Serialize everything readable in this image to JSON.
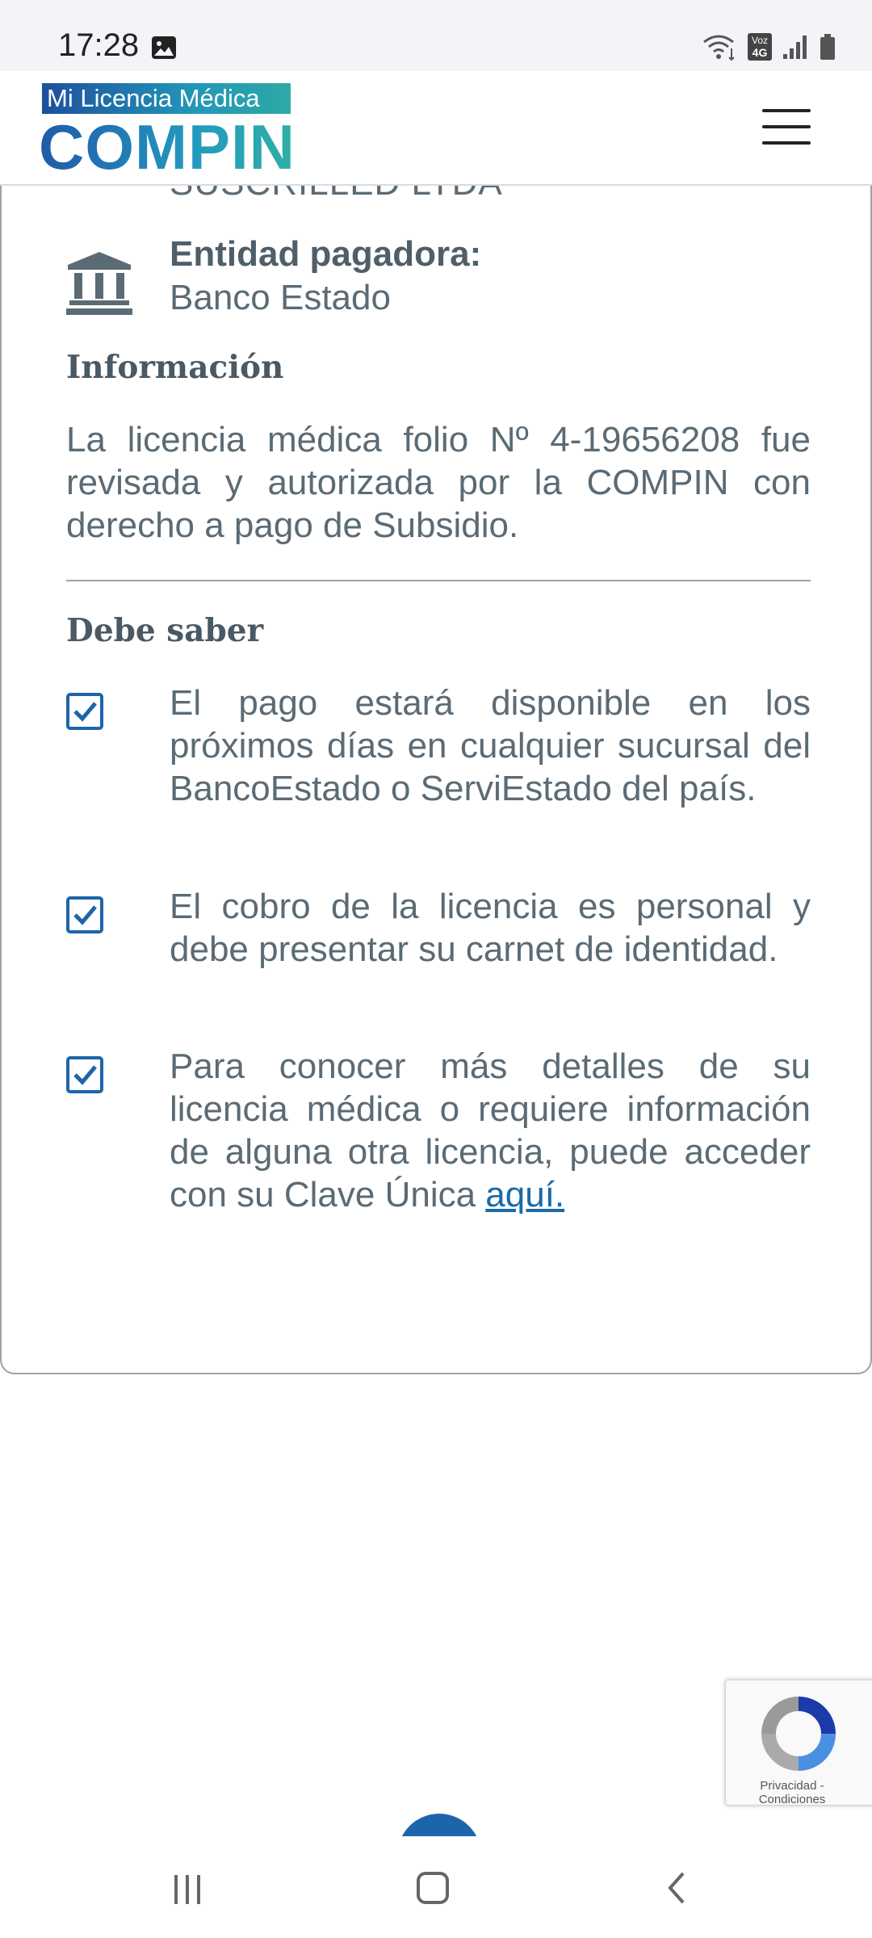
{
  "status_bar": {
    "time": "17:28",
    "icons": [
      "gallery-icon",
      "wifi-icon",
      "volte-icon",
      "signal-icon",
      "battery-icon"
    ],
    "volte_top": "Voz",
    "volte_bottom": "4G"
  },
  "header": {
    "logo_top": "Mi Licencia Médica",
    "logo_bottom": "COMPIN",
    "menu_icon": "hamburger-menu-icon"
  },
  "card": {
    "cut_text": "SUSCRILLED LTDA",
    "entidad_label": "Entidad pagadora:",
    "entidad_value": "Banco Estado",
    "info_title": "Información",
    "info_text": "La licencia médica folio Nº 4-19656208 fue revisada y autorizada por la COMPIN con derecho a pago de Subsidio.",
    "saber_title": "Debe saber",
    "items": [
      {
        "text": "El pago estará disponible en los próximos días en cualquier sucursal del BancoEstado o ServiEstado del país."
      },
      {
        "text": "El cobro de la licencia es personal y debe presentar su carnet de identidad."
      },
      {
        "text": "Para conocer más detalles de su licencia médica o requiere información de alguna otra licencia, puede acceder con su Clave Única ",
        "link": "aquí."
      }
    ]
  },
  "recaptcha": {
    "text": "Privacidad - Condiciones"
  },
  "colors": {
    "brand_blue": "#1f78c1",
    "text_gray": "#5b6b75",
    "link": "#1a6aa8"
  }
}
